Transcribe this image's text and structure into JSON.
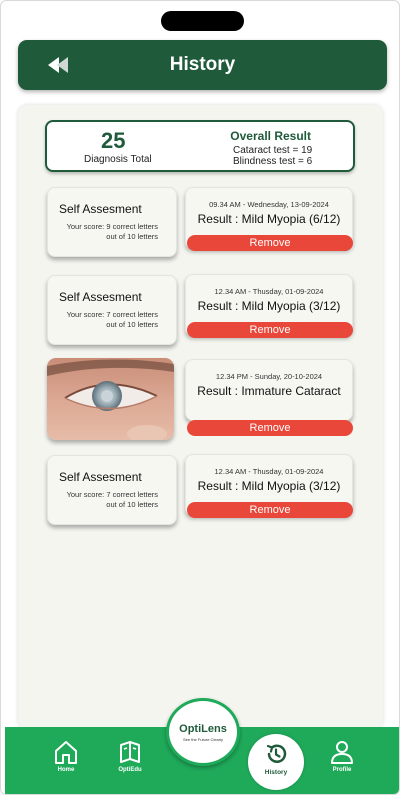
{
  "header": {
    "title": "History"
  },
  "summary": {
    "count": "25",
    "count_label": "Diagnosis Total",
    "overall_title": "Overall Result",
    "cataract_line": "Cataract test = 19",
    "blindness_line": "Blindness test = 6"
  },
  "entries": [
    {
      "left_title": "Self Assesment",
      "score_prefix": "Your score: ",
      "score_text": "9 correct letters",
      "score_text2": "out of 10 letters",
      "time": "09.34 AM - Wednesday, 13-09-2024",
      "result": "Result : Mild Myopia (6/12)",
      "remove": "Remove"
    },
    {
      "left_title": "Self Assesment",
      "score_prefix": "Your score: ",
      "score_text": "7 correct letters",
      "score_text2": "out of 10 letters",
      "time": "12.34 AM - Thusday, 01-09-2024",
      "result": "Result : Mild Myopia (3/12)",
      "remove": "Remove"
    },
    {
      "left_title": "",
      "time": "12.34 PM - Sunday, 20-10-2024",
      "result": "Result : Immature Cataract",
      "remove": "Remove"
    },
    {
      "left_title": "Self Assesment",
      "score_prefix": "Your score: ",
      "score_text": "7 correct letters",
      "score_text2": "out of 10 letters",
      "time": "12.34 AM - Thusday, 01-09-2024",
      "result": "Result : Mild Myopia (3/12)",
      "remove": "Remove"
    }
  ],
  "logo": {
    "name": "OptiLens",
    "tagline": "See the Future Clearly"
  },
  "nav": {
    "home": "Home",
    "optiedu": "OptiEdu",
    "history": "History",
    "profile": "Profile"
  },
  "colors": {
    "header_green": "#1f5a3a",
    "nav_green": "#1faa5a",
    "remove_red": "#e8473a"
  }
}
